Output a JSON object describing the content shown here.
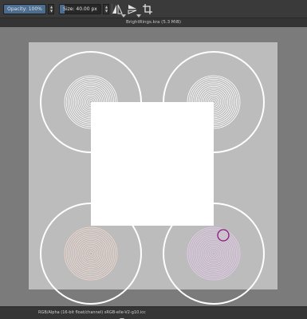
{
  "toolbar": {
    "opacity_label": "Opacity: 100%",
    "opacity_value": 1.0,
    "size_label": "Size: 40.00 px",
    "size_value": 0.12
  },
  "document": {
    "title": "BrightRings.kra (5.3 MiB)"
  },
  "statusbar": {
    "color_info": "RGB/Alpha (16-bit float/channel) sRGB-elle-V2-g10.icc"
  },
  "colors": {
    "toolbar_bg": "#3a3a3a",
    "canvas_bg": "#7b7b7b",
    "paper": "#bcbcbc",
    "accent": "#4a6d91",
    "brush_cursor": "#8a1a7a"
  }
}
